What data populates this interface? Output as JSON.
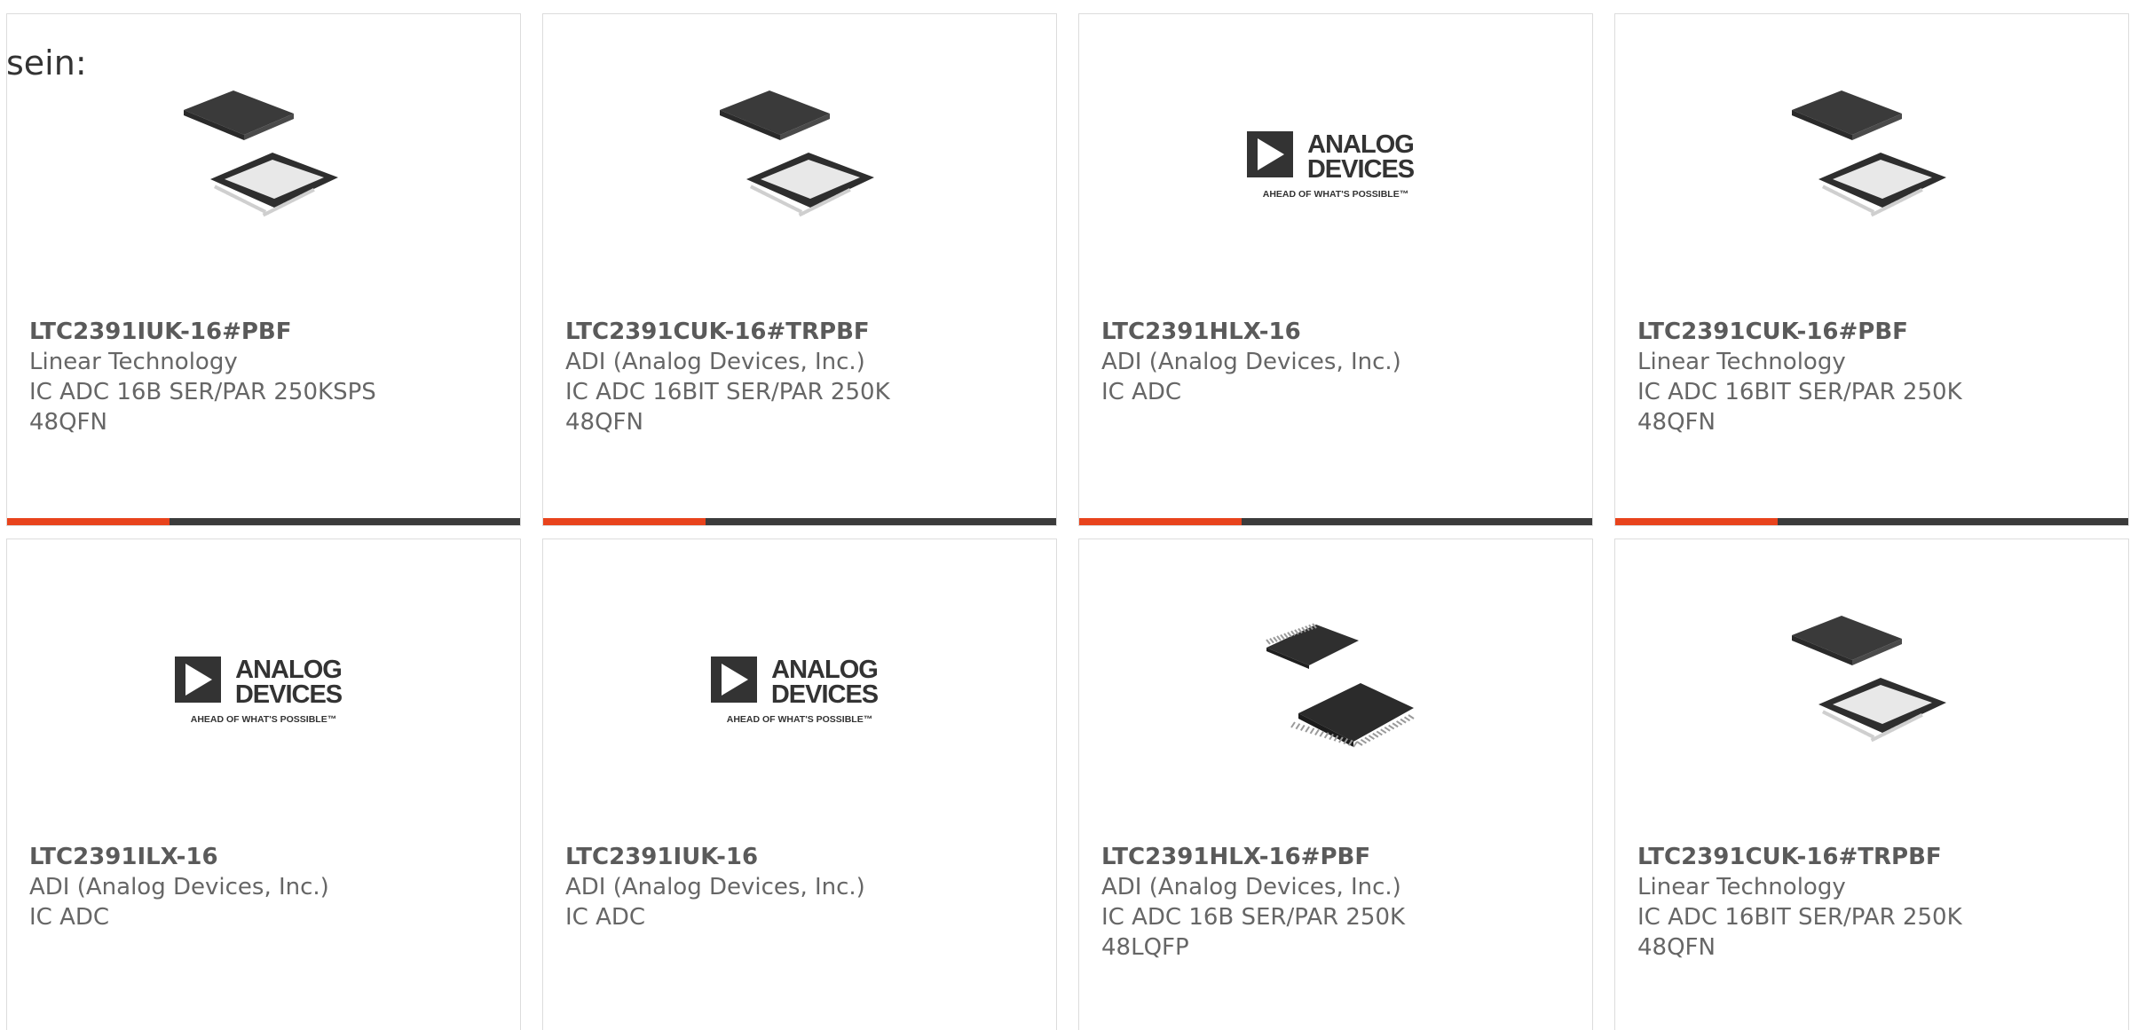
{
  "intro_text": "sein:",
  "colors": {
    "accent": "#e8431c",
    "bar": "#3b3b3b",
    "border": "#dcdcdc",
    "text": "#666666"
  },
  "products": [
    {
      "part_number": "LTC2391IUK-16#PBF",
      "manufacturer": "Linear Technology",
      "description_1": "IC ADC 16B SER/PAR 250KSPS",
      "description_2": "48QFN",
      "image": "qfn-chip-image"
    },
    {
      "part_number": "LTC2391CUK-16#TRPBF",
      "manufacturer": "ADI (Analog Devices, Inc.)",
      "description_1": "IC ADC 16BIT SER/PAR 250K",
      "description_2": "48QFN",
      "image": "qfn-chip-image"
    },
    {
      "part_number": "LTC2391HLX-16",
      "manufacturer": "ADI (Analog Devices, Inc.)",
      "description_1": "IC ADC",
      "description_2": "",
      "image": "analog-devices-logo"
    },
    {
      "part_number": "LTC2391CUK-16#PBF",
      "manufacturer": "Linear Technology",
      "description_1": "IC ADC 16BIT SER/PAR 250K",
      "description_2": "48QFN",
      "image": "qfn-chip-image"
    },
    {
      "part_number": "LTC2391ILX-16",
      "manufacturer": "ADI (Analog Devices, Inc.)",
      "description_1": "IC ADC",
      "description_2": "",
      "image": "analog-devices-logo"
    },
    {
      "part_number": "LTC2391IUK-16",
      "manufacturer": "ADI (Analog Devices, Inc.)",
      "description_1": "IC ADC",
      "description_2": "",
      "image": "analog-devices-logo"
    },
    {
      "part_number": "LTC2391HLX-16#PBF",
      "manufacturer": "ADI (Analog Devices, Inc.)",
      "description_1": "IC ADC 16B SER/PAR 250K",
      "description_2": "48LQFP",
      "image": "lqfp-chip-image"
    },
    {
      "part_number": "LTC2391CUK-16#TRPBF",
      "manufacturer": "Linear Technology",
      "description_1": "IC ADC 16BIT SER/PAR 250K",
      "description_2": "48QFN",
      "image": "qfn-chip-image"
    }
  ],
  "logo_lettering": {
    "line_1": "ANALOG",
    "line_2": "DEVICES",
    "tagline": "AHEAD OF WHAT'S POSSIBLE™"
  }
}
